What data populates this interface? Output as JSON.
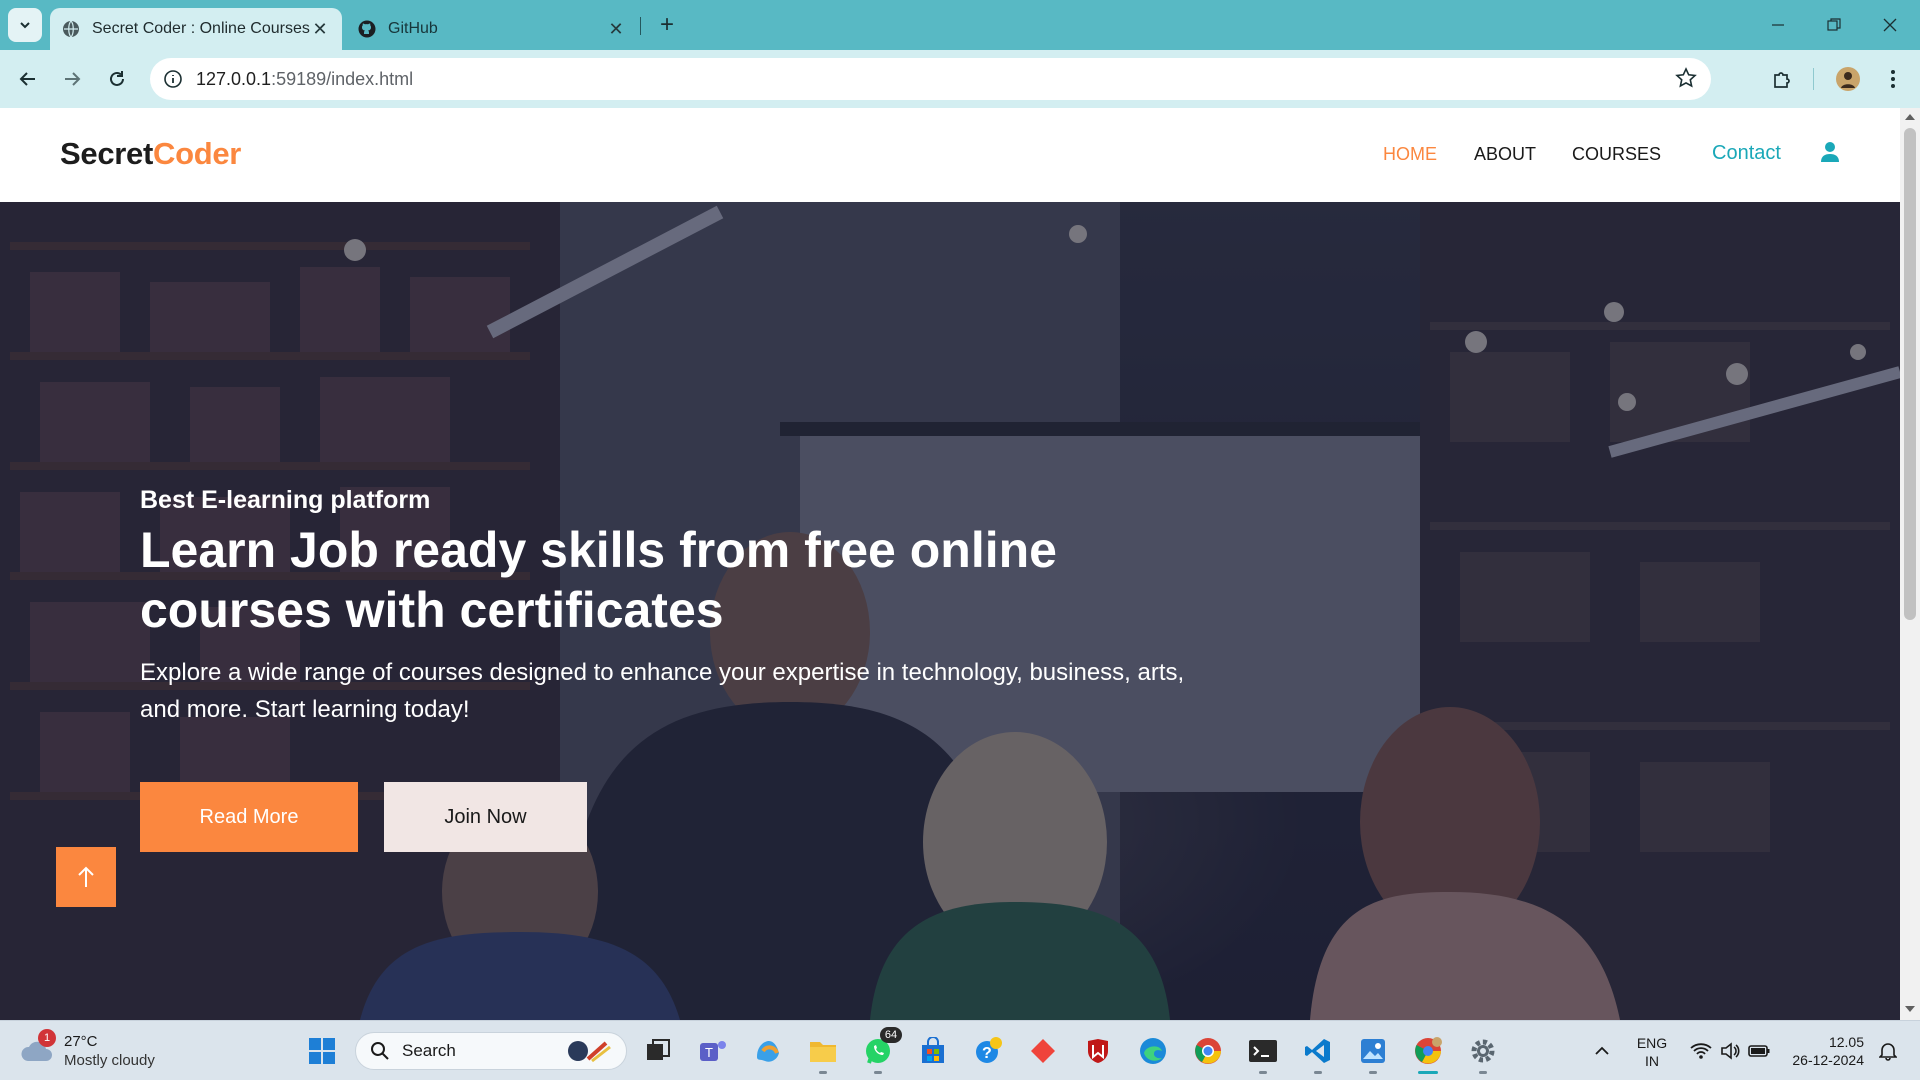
{
  "browser": {
    "tabs": [
      {
        "title": "Secret Coder : Online Courses",
        "active": true,
        "favicon": "globe-icon"
      },
      {
        "title": "GitHub",
        "active": false,
        "favicon": "github-icon"
      }
    ],
    "url_host": "127.0.0.1",
    "url_path": ":59189/index.html",
    "accent": "#58b9c4"
  },
  "site": {
    "logo_part1": "Secret",
    "logo_part2": "Coder",
    "nav": {
      "home": "HOME",
      "about": "ABOUT",
      "courses": "COURSES",
      "contact": "Contact"
    },
    "brand_color": "#fb873f",
    "contact_color": "#1aa8b8"
  },
  "hero": {
    "eyebrow": "Best E-learning platform",
    "title": "Learn Job ready skills from free online courses with certificates",
    "subtitle": "Explore a wide range of courses designed to enhance your expertise in technology, business, arts, and more. Start learning today!",
    "read_more": "Read More",
    "join_now": "Join Now"
  },
  "taskbar": {
    "weather_temp": "27°C",
    "weather_cond": "Mostly cloudy",
    "weather_badge": "1",
    "search_label": "Search",
    "whatsapp_badge": "64",
    "lang_line1": "ENG",
    "lang_line2": "IN",
    "time": "12.05",
    "date": "26-12-2024"
  }
}
